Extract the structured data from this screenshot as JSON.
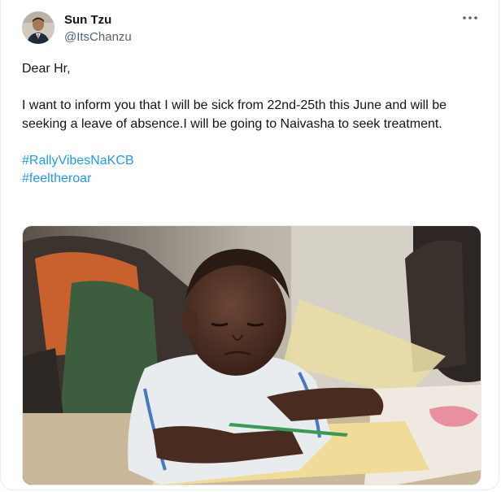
{
  "author": {
    "display_name": "Sun Tzu",
    "handle": "@ItsChanzu",
    "avatar_icon": "avatar-portrait"
  },
  "more_menu": {
    "icon": "more-horizontal-icon"
  },
  "tweet": {
    "greeting": "Dear Hr,",
    "body": "I want to inform you that I will be sick from 22nd-25th this June and will be seeking a leave of absence.I will be going to Naivasha to seek treatment.",
    "hashtags": [
      "#RallyVibesNaKCB",
      "#feeltheroar"
    ]
  },
  "media": {
    "kind": "photo"
  },
  "colors": {
    "text": "#0f1419",
    "secondary": "#536471",
    "link": "#1d9bf0",
    "border": "#e6ecf0"
  }
}
